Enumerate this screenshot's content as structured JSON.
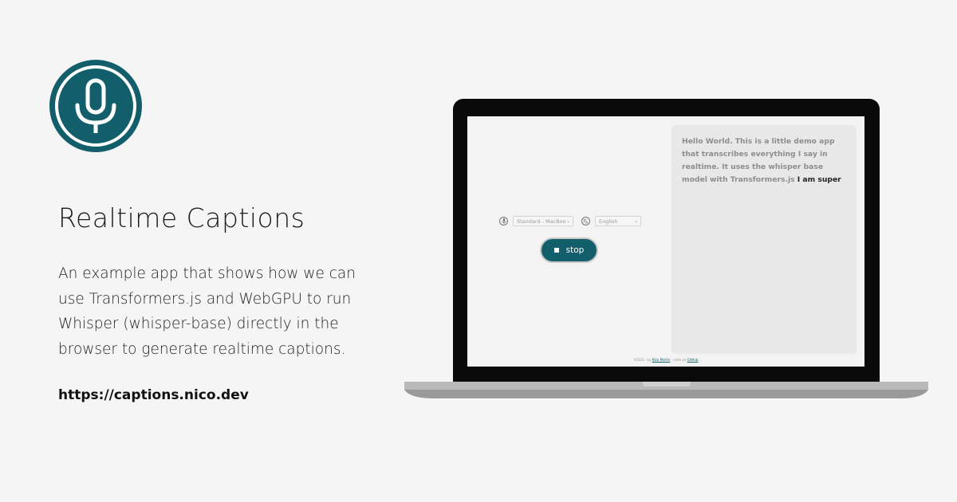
{
  "colors": {
    "brand": "#125f6b",
    "background": "#f5f5f5"
  },
  "logo": {
    "icon": "microphone-icon"
  },
  "hero": {
    "title": "Realtime Captions",
    "description": "An example app that shows how we can use Transformers.js and WebGPU to run Whisper (whisper-base) directly in the browser to generate realtime captions.",
    "url": "https://captions.nico.dev"
  },
  "app": {
    "device_icon": "microphone-icon",
    "device_select": "Standard - MacBoo",
    "language_icon": "translate-icon",
    "language_select": "English",
    "stop_button": "stop",
    "transcript_final": "Hello World. This is a little demo app that transcribes everything I say in realtime. It uses the whisper base model with Transformers.js",
    "transcript_live": "I am super",
    "footer": {
      "prefix": "V2024 - by",
      "author": "Nico Martin",
      "middle": "- code on",
      "code": "GitHub"
    }
  }
}
